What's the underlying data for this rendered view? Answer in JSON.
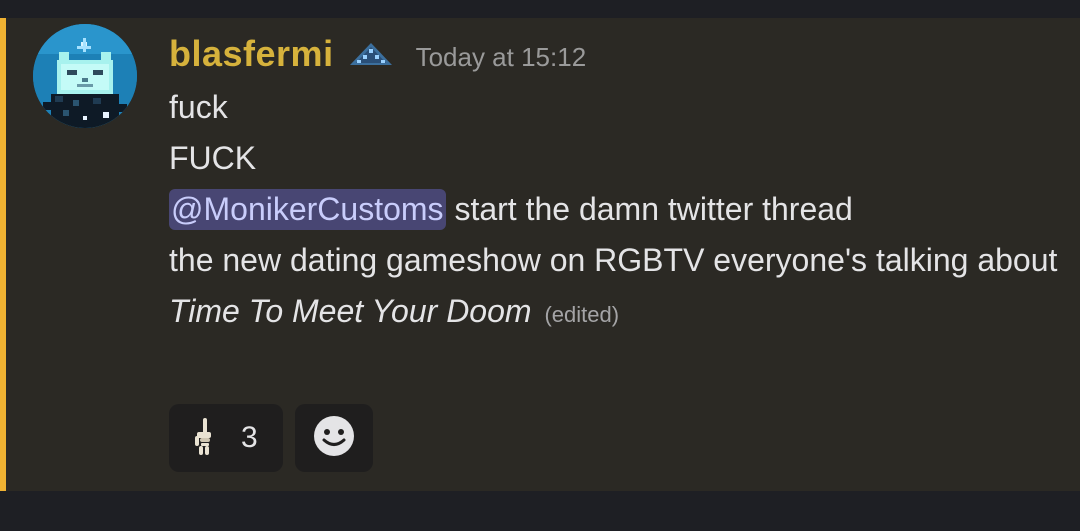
{
  "message": {
    "username": "blasfermi",
    "username_color": "#d6b23c",
    "role_icon": "blue-pixel-pyramid-icon",
    "timestamp": "Today at 15:12",
    "lines": {
      "l1": "fuck",
      "l2": "FUCK",
      "l3_mention": "@MonikerCustoms",
      "l3_rest": " start the damn twitter thread",
      "l4": "the new dating gameshow on RGBTV everyone's talking about",
      "l5": "Time To Meet Your Doom",
      "edited": "(edited)"
    },
    "highlight_color": "#f0b232",
    "mention_bg": "#484673"
  },
  "reactions": [
    {
      "emoji": "skeleton-hand-pointing-up-icon",
      "count": "3"
    },
    {
      "emoji": "add-reaction-smiley-icon"
    }
  ]
}
